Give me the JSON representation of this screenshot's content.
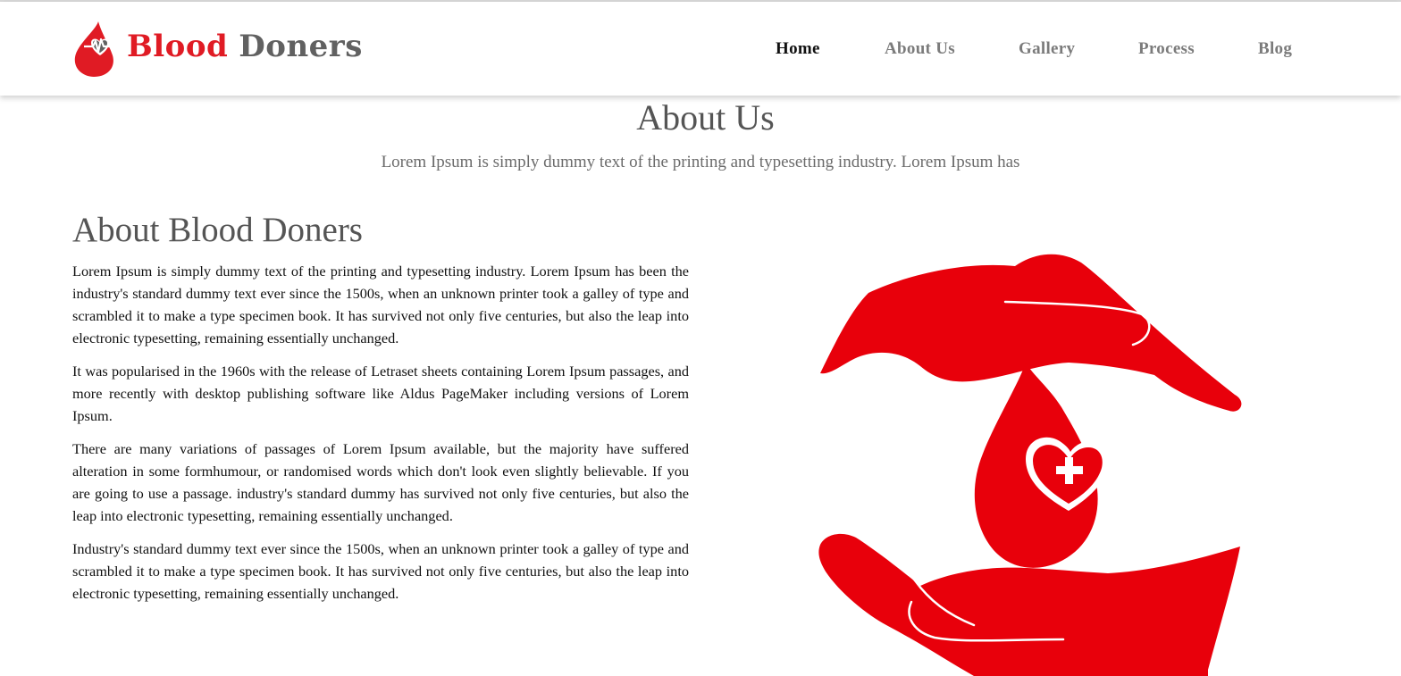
{
  "brand": {
    "name_part1": "Blood",
    "name_part2": "Doners",
    "color_red": "#e01b24",
    "color_gray": "#616161"
  },
  "nav": {
    "items": [
      {
        "label": "Home",
        "active": true
      },
      {
        "label": "About Us",
        "active": false
      },
      {
        "label": "Gallery",
        "active": false
      },
      {
        "label": "Process",
        "active": false
      },
      {
        "label": "Blog",
        "active": false
      }
    ]
  },
  "about": {
    "title": "About Us",
    "subtitle": "Lorem Ipsum is simply dummy text of the printing and typesetting industry. Lorem Ipsum has"
  },
  "section": {
    "heading": "About Blood Doners",
    "paragraphs": [
      "Lorem Ipsum is simply dummy text of the printing and typesetting industry. Lorem Ipsum has been the industry's standard dummy text ever since the 1500s, when an unknown printer took a galley of type and scrambled it to make a type specimen book. It has survived not only five centuries, but also the leap into electronic typesetting, remaining essentially unchanged.",
      "It was popularised in the 1960s with the release of Letraset sheets containing Lorem Ipsum passages, and more recently with desktop publishing software like Aldus PageMaker including versions of Lorem Ipsum.",
      "There are many variations of passages of Lorem Ipsum available, but the majority have suffered alteration in some formhumour, or randomised words which don't look even slightly believable. If you are going to use a passage. industry's standard dummy has survived not only five centuries, but also the leap into electronic typesetting, remaining essentially unchanged.",
      "Industry's standard dummy text ever since the 1500s, when an unknown printer took a galley of type and scrambled it to make a type specimen book. It has survived not only five centuries, but also the leap into electronic typesetting, remaining essentially unchanged."
    ]
  },
  "illustration": {
    "icon": "hands-protecting-blood-drop-icon",
    "color": "#e8000b"
  }
}
